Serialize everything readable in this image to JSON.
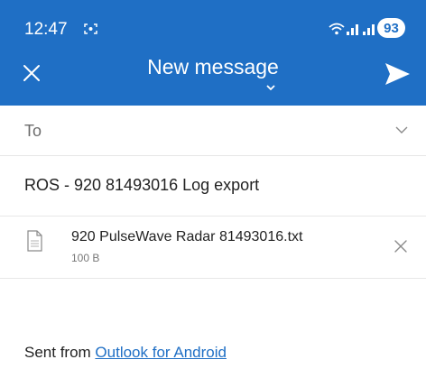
{
  "status_bar": {
    "time": "12:47",
    "battery": "93"
  },
  "header": {
    "title": "New message",
    "close_icon": "close-icon",
    "send_icon": "send-icon",
    "background": "#1f6fc5"
  },
  "to": {
    "label": "To"
  },
  "subject": {
    "value": "ROS - 920 81493016 Log export"
  },
  "attachment": {
    "name": "920 PulseWave Radar 81493016.txt",
    "size": "100 B"
  },
  "body": {
    "signature_prefix": "Sent from ",
    "signature_link": "Outlook for Android"
  }
}
